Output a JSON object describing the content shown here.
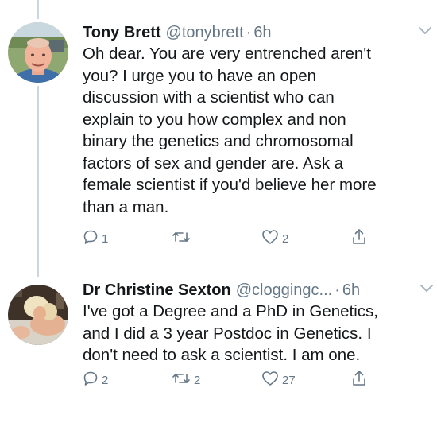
{
  "tweets": [
    {
      "name": "Tony Brett",
      "handle": "@tonybrett",
      "separator": "·",
      "time": "6h",
      "text": "Oh dear. You are very entrenched aren't\nyou? I urge you to have an open\ndiscussion with a scientist who can\nexplain to you how complex and non\nbinary the genetics and chromosomal\nfactors of sex and gender are. Ask a\nfemale scientist if you'd believe her more\nthan a man.",
      "replies": "1",
      "retweets": "",
      "likes": "2",
      "icons": [
        "reply-icon",
        "retweet-icon",
        "like-icon",
        "share-icon",
        "chevron-down-icon"
      ]
    },
    {
      "name": "Dr Christine Sexton",
      "handle": "@cloggingc...",
      "separator": "·",
      "time": "6h",
      "text": "I've got a Degree and a PhD in Genetics,\nand I did a 3 year Postdoc in Genetics. I\ndon't need to ask a scientist. I am one.",
      "replies": "2",
      "retweets": "2",
      "likes": "27",
      "icons": [
        "reply-icon",
        "retweet-icon",
        "like-icon",
        "share-icon",
        "chevron-down-icon"
      ]
    }
  ],
  "colors": {
    "text": "#14171a",
    "secondary": "#657786",
    "thread_line": "#ccd6dd",
    "divider": "#e6ecf0"
  }
}
